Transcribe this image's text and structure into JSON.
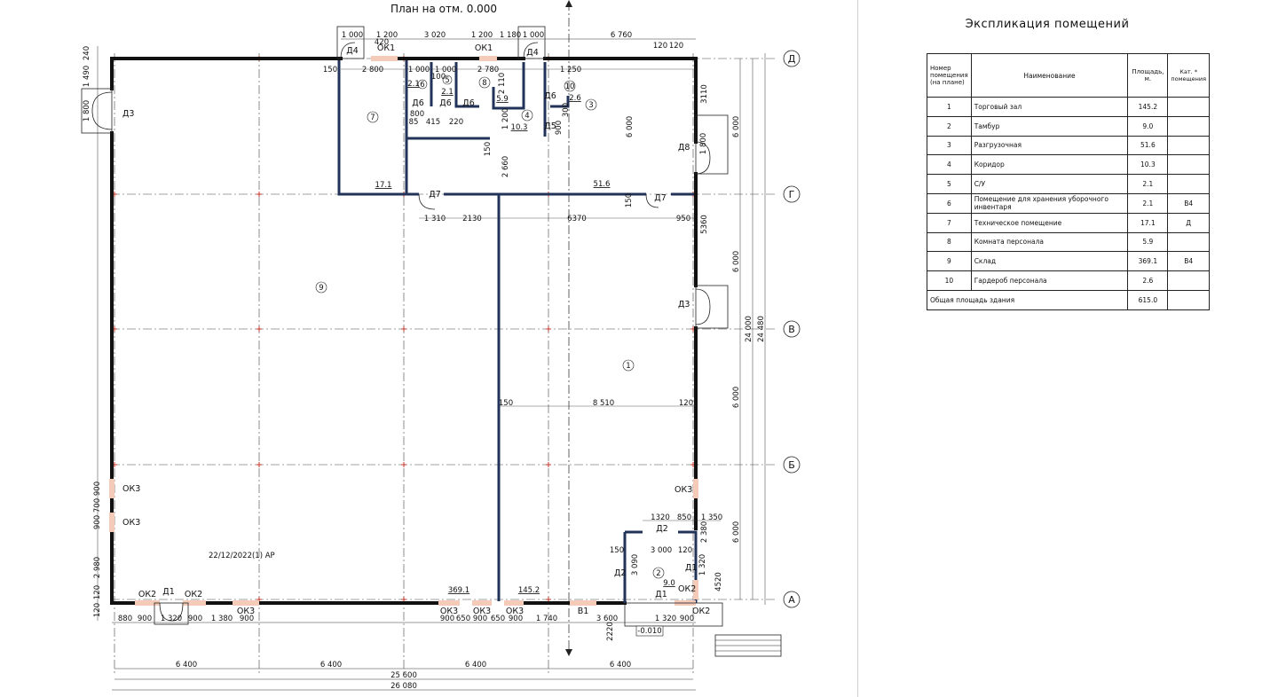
{
  "plan": {
    "title": "План на отм. 0.000",
    "date_stamp": "22/12/2022(1) АР",
    "axes_h": [
      "Д",
      "Г",
      "В",
      "Б",
      "А"
    ],
    "rooms": [
      {
        "num": "1",
        "area": "145.2"
      },
      {
        "num": "2",
        "area": "9.0"
      },
      {
        "num": "3",
        "area": "51.6"
      },
      {
        "num": "4",
        "area": "10.3"
      },
      {
        "num": "5",
        "area": "2.1"
      },
      {
        "num": "6",
        "area": "2.1"
      },
      {
        "num": "7",
        "area": "17.1"
      },
      {
        "num": "8",
        "area": "5.9"
      },
      {
        "num": "9",
        "area": "369.1"
      },
      {
        "num": "10",
        "area": "2.6"
      }
    ],
    "elevation_mark": "-0.010",
    "openings": {
      "d1": "Д1",
      "d2": "Д2",
      "d3": "Д3",
      "d4": "Д4",
      "d5": "Д5",
      "d6": "Д6",
      "d7": "Д7",
      "d8": "Д8",
      "ok1": "ОК1",
      "ok2": "ОК2",
      "ok3": "ОК3",
      "v1": "В1"
    },
    "dims_top": {
      "a": "1 000",
      "b": "1 200",
      "c": "3 020",
      "d": "1 200",
      "e": "1 180",
      "f": "1 000",
      "g": "6 760",
      "h": "120",
      "i": "120",
      "j": "420"
    },
    "dims_bottom_chain": [
      "880",
      "900",
      "1 320",
      "900",
      "1 380",
      "900",
      "900",
      "650",
      "900",
      "650",
      "900",
      "1 740",
      "3 600",
      "1 320",
      "900"
    ],
    "dims_bottom_axes": [
      "6 400",
      "6 400",
      "6 400",
      "6 400"
    ],
    "dim_total_axes": "25 600",
    "dim_total_overall": "26 080",
    "dims_right_axes": [
      "6 000",
      "6 000",
      "6 000",
      "6 000"
    ],
    "dim_right_total": "24 000",
    "dim_right_overall": "24 480",
    "dims_left": [
      "240",
      "1 490",
      "1 800",
      "900",
      "700",
      "900",
      "2 980",
      "120",
      "120"
    ],
    "dims_inner": {
      "r1": "2 800",
      "r2": "1 000",
      "r3": "100",
      "r4": "1 000",
      "r5": "2 780",
      "r6": "1 250",
      "r7": "150",
      "r8": "800",
      "r9": "415",
      "r10": "220",
      "r11": "85",
      "r12": "1 200",
      "r13": "2 660",
      "r14": "6 000",
      "r15": "1 310",
      "r16": "2130",
      "r17": "6370",
      "r18": "950",
      "r19": "5360",
      "r20": "3110",
      "r21": "8 510",
      "r22": "1320",
      "r23": "850",
      "r24": "1 350",
      "r25": "3 000",
      "r26": "2 380",
      "r27": "4520",
      "r28": "2220",
      "r29": "3 090",
      "r30": "1 320",
      "r31": "2 110",
      "r32": "300",
      "r33": "900",
      "r34": "1 800",
      "r35": "2.6",
      "r36": "150",
      "r37": "120"
    }
  },
  "explication": {
    "title": "Экспликация помещений",
    "headers": {
      "num": "Номер помещения (на плане)",
      "name": "Наименование",
      "area": "Площадь, м.",
      "cat": "Кат. * помещения"
    },
    "rows": [
      {
        "num": "1",
        "name": "Торговый зал",
        "area": "145.2",
        "cat": ""
      },
      {
        "num": "2",
        "name": "Тамбур",
        "area": "9.0",
        "cat": ""
      },
      {
        "num": "3",
        "name": "Разгрузочная",
        "area": "51.6",
        "cat": ""
      },
      {
        "num": "4",
        "name": "Коридор",
        "area": "10.3",
        "cat": ""
      },
      {
        "num": "5",
        "name": "С/У",
        "area": "2.1",
        "cat": ""
      },
      {
        "num": "6",
        "name": "Помещение для хранения уборочного инвентаря",
        "area": "2.1",
        "cat": "В4"
      },
      {
        "num": "7",
        "name": "Техническое помещение",
        "area": "17.1",
        "cat": "Д"
      },
      {
        "num": "8",
        "name": "Комната персонала",
        "area": "5.9",
        "cat": ""
      },
      {
        "num": "9",
        "name": "Склад",
        "area": "369.1",
        "cat": "В4"
      },
      {
        "num": "10",
        "name": "Гардероб персонала",
        "area": "2.6",
        "cat": ""
      }
    ],
    "total_label": "Общая площадь здания",
    "total_value": "615.0"
  }
}
